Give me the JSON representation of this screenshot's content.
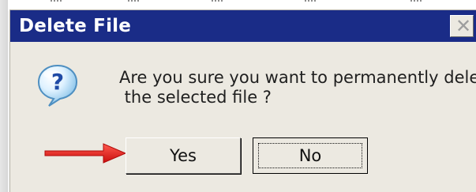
{
  "window": {
    "title": "Delete File",
    "close_glyph": "✕"
  },
  "dialog": {
    "icon": "question-icon",
    "message_lines": [
      "Are you sure you want to permanently delete",
      " the selected file ?"
    ],
    "buttons": {
      "yes_label": "Yes",
      "no_label": "No"
    }
  },
  "annotation": {
    "arrow_icon": "red-arrow-icon",
    "arrow_color": "#dd1717"
  },
  "colors": {
    "titlebar": "#1a2c87",
    "dialog_bg": "#ece9e1"
  }
}
